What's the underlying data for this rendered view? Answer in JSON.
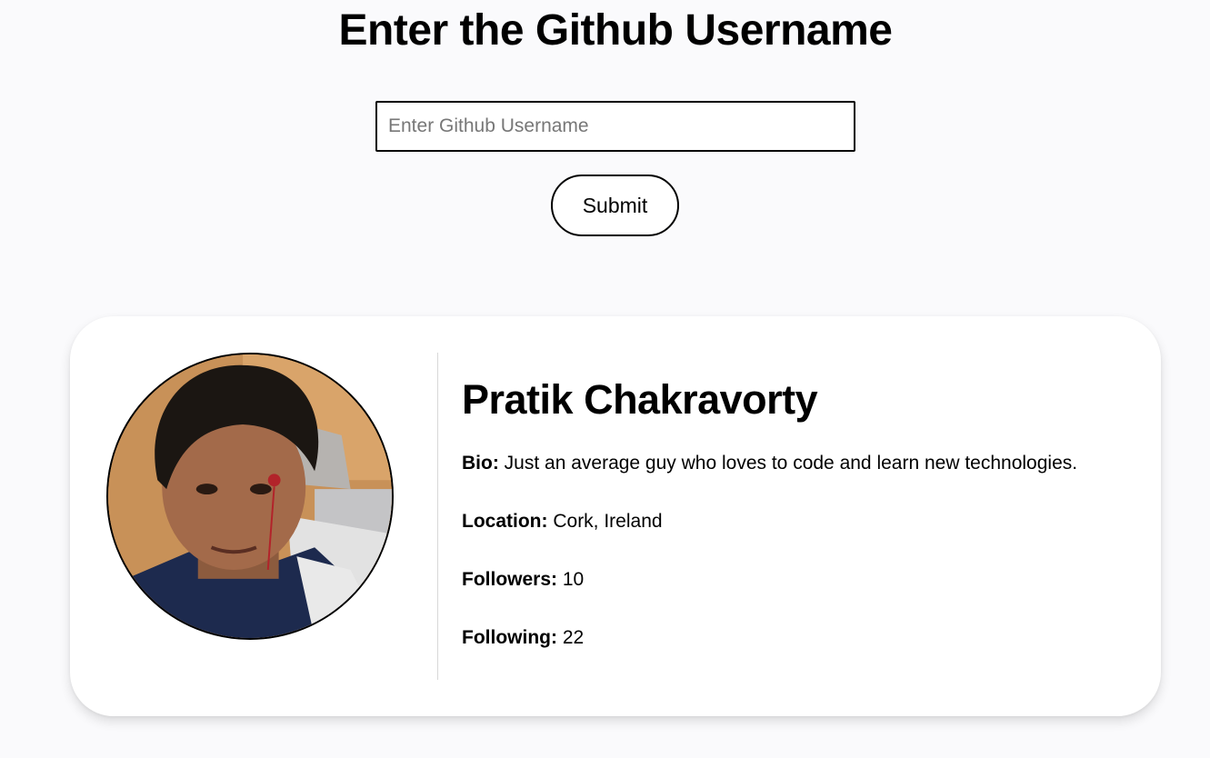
{
  "header": {
    "title": "Enter the Github Username"
  },
  "search": {
    "placeholder": "Enter Github Username",
    "value": "",
    "submit_label": "Submit"
  },
  "profile": {
    "name": "Pratik Chakravorty",
    "bio_label": "Bio:",
    "bio": "Just an average guy who loves to code and learn new technologies.",
    "location_label": "Location:",
    "location": "Cork, Ireland",
    "followers_label": "Followers:",
    "followers": "10",
    "following_label": "Following:",
    "following": "22"
  },
  "colors": {
    "page_background": "#fafafc",
    "card_background": "#ffffff",
    "text": "#000000"
  }
}
